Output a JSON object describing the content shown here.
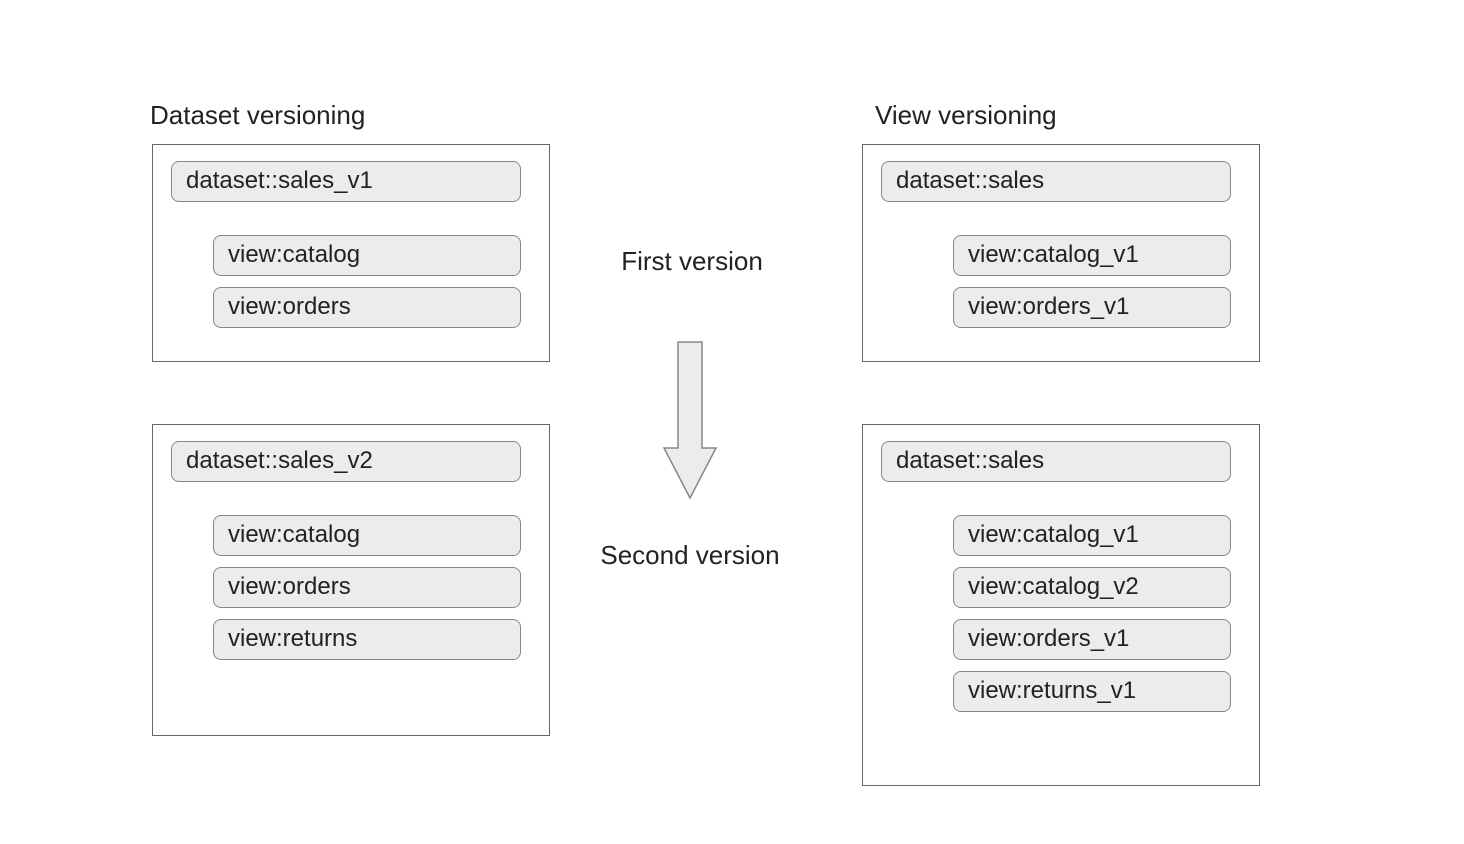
{
  "left": {
    "heading": "Dataset versioning",
    "block1": {
      "dataset": "dataset::sales_v1",
      "views": [
        "view:catalog",
        "view:orders"
      ]
    },
    "block2": {
      "dataset": "dataset::sales_v2",
      "views": [
        "view:catalog",
        "view:orders",
        "view:returns"
      ]
    }
  },
  "right": {
    "heading": "View versioning",
    "block1": {
      "dataset": "dataset::sales",
      "views": [
        "view:catalog_v1",
        "view:orders_v1"
      ]
    },
    "block2": {
      "dataset": "dataset::sales",
      "views": [
        "view:catalog_v1",
        "view:catalog_v2",
        "view:orders_v1",
        "view:returns_v1"
      ]
    }
  },
  "middle": {
    "first": "First version",
    "second": "Second version"
  }
}
